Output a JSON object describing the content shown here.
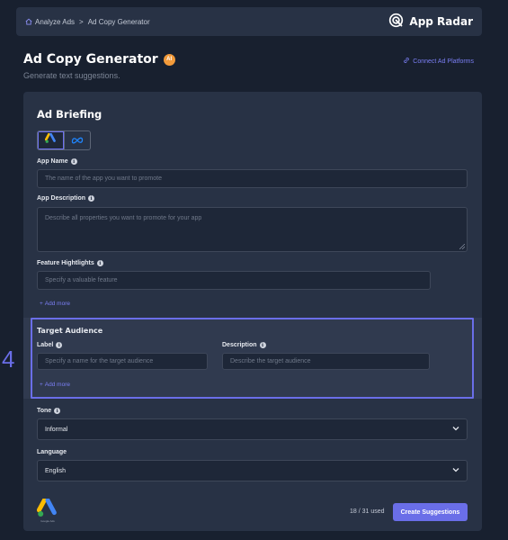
{
  "breadcrumb": {
    "items": [
      "Analyze Ads",
      "Ad Copy Generator"
    ],
    "separator": ">"
  },
  "brand": {
    "name": "App Radar"
  },
  "header": {
    "title": "Ad Copy Generator",
    "ai_badge": "AI",
    "subtitle": "Generate text suggestions.",
    "connect_link": "Connect Ad Platforms"
  },
  "briefing": {
    "title": "Ad Briefing",
    "platforms": [
      {
        "icon": "google-ads-icon",
        "selected": true
      },
      {
        "icon": "meta-icon",
        "selected": false
      }
    ],
    "app_name": {
      "label": "App Name",
      "placeholder": "The name of the app you want to promote"
    },
    "app_description": {
      "label": "App Description",
      "placeholder": "Describe all properties you want to promote for your app"
    },
    "feature_highlights": {
      "label": "Feature Hightlights",
      "placeholder": "Specify a valuable feature",
      "add_more": "Add more"
    },
    "target_audience": {
      "title": "Target Audience",
      "label_field": {
        "label": "Label",
        "placeholder": "Specify a name for the target audience"
      },
      "description_field": {
        "label": "Description",
        "placeholder": "Describe the target audience"
      },
      "add_more": "Add more",
      "step_number": "4"
    },
    "tone": {
      "label": "Tone",
      "value": "Informal"
    },
    "language": {
      "label": "Language",
      "value": "English"
    }
  },
  "footer": {
    "google_logo_caption": "Google Ads",
    "usage": "18 / 31 used",
    "create_button": "Create Suggestions"
  },
  "colors": {
    "accent": "#6a6ee8",
    "background": "#18202f",
    "card": "#283245",
    "ai_badge": "#f29a3a"
  }
}
